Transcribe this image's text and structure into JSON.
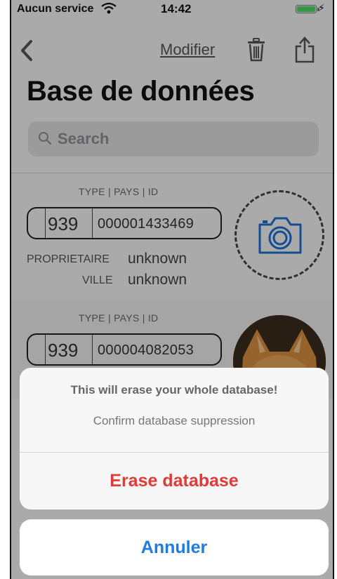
{
  "status": {
    "carrier": "Aucun service",
    "time": "14:42",
    "battery_level": 1.0
  },
  "nav": {
    "modify_label": "Modifier",
    "icons": [
      "back-chevron-icon",
      "trash-icon",
      "share-icon"
    ]
  },
  "page_title": "Base de données",
  "search": {
    "placeholder": "Search"
  },
  "records": [
    {
      "header": "TYPE | PAYS | ID",
      "country_code": "939",
      "id": "000001433469",
      "owner_label": "PROPRIETAIRE",
      "owner": "unknown",
      "city_label": "VILLE",
      "city": "unknown",
      "photo": "camera-placeholder-icon"
    },
    {
      "header": "TYPE | PAYS | ID",
      "country_code": "939",
      "id": "000004082053",
      "photo": "cat-photo"
    }
  ],
  "alert": {
    "message": "This will erase your whole database!",
    "detail": "Confirm database suppression",
    "erase_label": "Erase database",
    "cancel_label": "Annuler"
  },
  "colors": {
    "destructive": "#e53935",
    "action": "#1d7ce5",
    "battery": "#4cd964"
  }
}
